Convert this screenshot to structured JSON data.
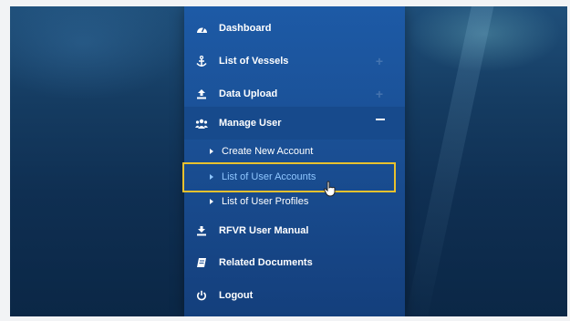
{
  "menu": {
    "items": [
      {
        "label": "Dashboard",
        "icon": "dashboard-icon"
      },
      {
        "label": "List of Vessels",
        "icon": "anchor-icon",
        "expander": "+"
      },
      {
        "label": "Data Upload",
        "icon": "upload-icon",
        "expander": "+"
      },
      {
        "label": "Manage User",
        "icon": "users-icon",
        "expanded": true
      },
      {
        "label": "RFVR User Manual",
        "icon": "download-icon"
      },
      {
        "label": "Related Documents",
        "icon": "document-icon"
      },
      {
        "label": "Logout",
        "icon": "power-icon"
      }
    ],
    "submenu": [
      {
        "label": "Create New Account"
      },
      {
        "label": "List of User Accounts",
        "selected": true
      },
      {
        "label": "List of User Profiles"
      }
    ]
  },
  "colors": {
    "menu_bg": "#1a4f94",
    "highlight_border": "#e8c12e",
    "selected_text": "#8fc6ff"
  }
}
